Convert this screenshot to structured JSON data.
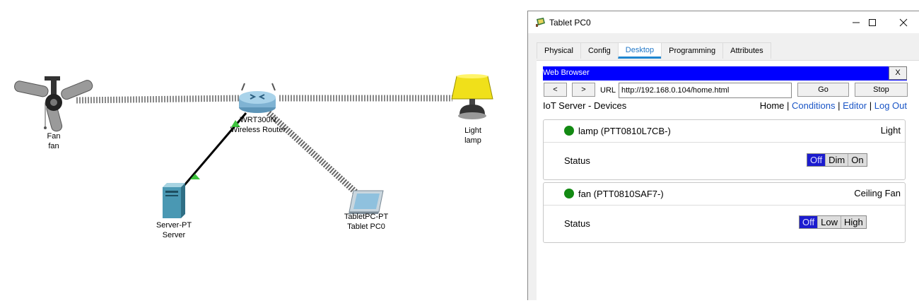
{
  "topology": {
    "devices": [
      {
        "id": "fan",
        "type": "Fan",
        "name": "fan"
      },
      {
        "id": "router",
        "type": "WRT300N",
        "name": "Wireless Router"
      },
      {
        "id": "light",
        "type": "Light",
        "name": "lamp"
      },
      {
        "id": "server",
        "type": "Server-PT",
        "name": "Server"
      },
      {
        "id": "tablet",
        "type": "TabletPC-PT",
        "name": "Tablet PC0"
      }
    ]
  },
  "window": {
    "title": "Tablet PC0",
    "tabs": [
      "Physical",
      "Config",
      "Desktop",
      "Programming",
      "Attributes"
    ],
    "active_tab": "Desktop"
  },
  "browser": {
    "title": "Web Browser",
    "close_label": "X",
    "back_label": "<",
    "forward_label": ">",
    "url_label": "URL",
    "url": "http://192.168.0.104/home.html",
    "go_label": "Go",
    "stop_label": "Stop"
  },
  "page": {
    "title": "IoT Server - Devices",
    "nav": {
      "home": "Home",
      "conditions": "Conditions",
      "editor": "Editor",
      "logout": "Log Out",
      "sep": "|"
    },
    "devices": [
      {
        "name": "lamp (PTT0810L7CB-)",
        "type": "Light",
        "status_label": "Status",
        "options": [
          "Off",
          "Dim",
          "On"
        ],
        "selected": "Off",
        "status_color": "#138a13"
      },
      {
        "name": "fan (PTT0810SAF7-)",
        "type": "Ceiling Fan",
        "status_label": "Status",
        "options": [
          "Off",
          "Low",
          "High"
        ],
        "selected": "Off",
        "status_color": "#138a13"
      }
    ]
  },
  "colors": {
    "browser_bar": "#0000ff",
    "active_tab": "#1f86d0",
    "link": "#1a55c6",
    "selected_option": "#1c1ccf"
  }
}
